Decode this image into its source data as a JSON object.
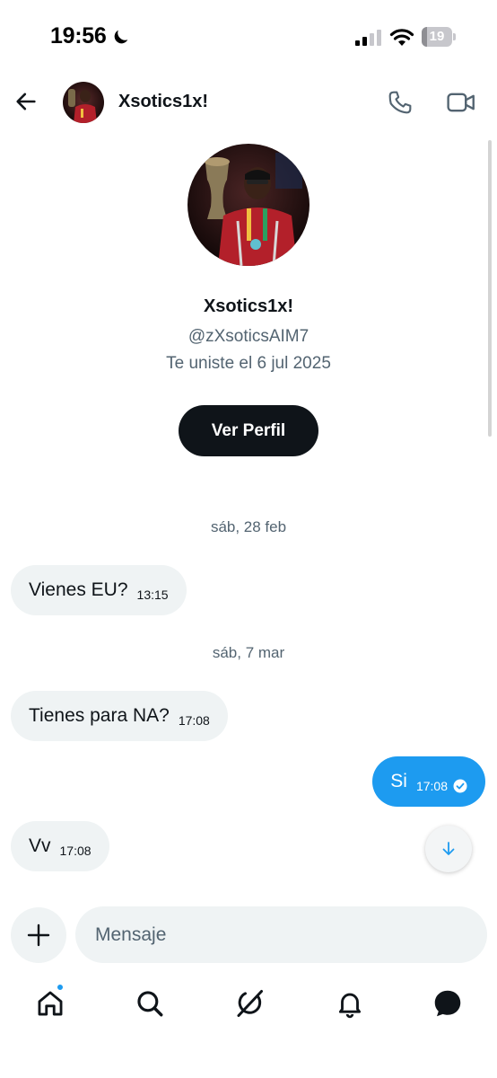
{
  "status_bar": {
    "time": "19:56",
    "battery": "19",
    "battery_level": 0.19,
    "icons": [
      "moon-icon",
      "signal-icon",
      "wifi-icon",
      "battery-icon"
    ]
  },
  "header": {
    "name": "Xsotics1x!",
    "icons": [
      "back-arrow-icon",
      "phone-icon",
      "video-icon"
    ]
  },
  "profile": {
    "name": "Xsotics1x!",
    "handle": "@zXsoticsAIM7",
    "joined": "Te uniste el 6 jul 2025",
    "button": "Ver Perfil"
  },
  "messages": [
    {
      "type": "date",
      "text": "sáb, 28 feb"
    },
    {
      "type": "in",
      "text": "Vienes EU?",
      "time": "13:15"
    },
    {
      "type": "date",
      "text": "sáb, 7 mar"
    },
    {
      "type": "in",
      "text": "Tienes para NA?",
      "time": "17:08"
    },
    {
      "type": "out",
      "text": "Si",
      "time": "17:08",
      "status": "read"
    },
    {
      "type": "in",
      "text": "Vv",
      "time": "17:08"
    }
  ],
  "composer": {
    "placeholder": "Mensaje"
  },
  "nav": {
    "items": [
      "home-icon",
      "search-icon",
      "grok-icon",
      "notifications-icon",
      "messages-icon"
    ],
    "home_has_notification": true
  },
  "colors": {
    "accent": "#1d9bf0",
    "text_primary": "#0f1419",
    "text_secondary": "#536471",
    "bubble_in": "#eff3f4",
    "button_dark": "#0f1419"
  }
}
